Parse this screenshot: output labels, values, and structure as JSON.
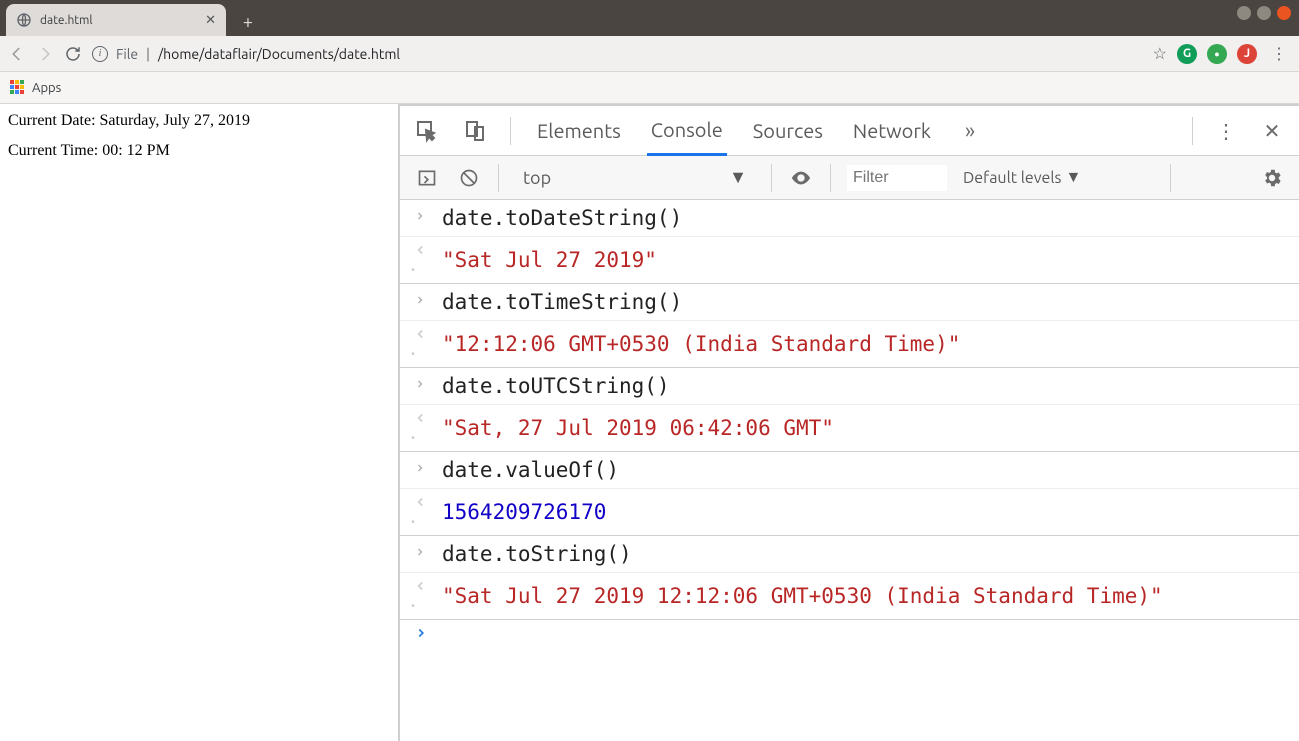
{
  "tab": {
    "title": "date.html"
  },
  "url": {
    "prefix": "File",
    "path": "/home/dataflair/Documents/date.html"
  },
  "bookmarks": {
    "apps": "Apps"
  },
  "page": {
    "line1": "Current Date: Saturday, July 27, 2019",
    "line2": "Current Time: 00: 12 PM"
  },
  "devtools": {
    "tabs": {
      "elements": "Elements",
      "console": "Console",
      "sources": "Sources",
      "network": "Network"
    },
    "context": "top",
    "filter_placeholder": "Filter",
    "levels": "Default levels"
  },
  "console": [
    {
      "kind": "in",
      "text": "date.toDateString()"
    },
    {
      "kind": "out",
      "type": "str",
      "text": "\"Sat Jul 27 2019\""
    },
    {
      "kind": "in",
      "text": "date.toTimeString()"
    },
    {
      "kind": "out",
      "type": "str",
      "text": "\"12:12:06 GMT+0530 (India Standard Time)\""
    },
    {
      "kind": "in",
      "text": "date.toUTCString()"
    },
    {
      "kind": "out",
      "type": "str",
      "text": "\"Sat, 27 Jul 2019 06:42:06 GMT\""
    },
    {
      "kind": "in",
      "text": "date.valueOf()"
    },
    {
      "kind": "out",
      "type": "num",
      "text": "1564209726170"
    },
    {
      "kind": "in",
      "text": "date.toString()"
    },
    {
      "kind": "out",
      "type": "str",
      "text": "\"Sat Jul 27 2019 12:12:06 GMT+0530 (India Standard Time)\""
    }
  ]
}
